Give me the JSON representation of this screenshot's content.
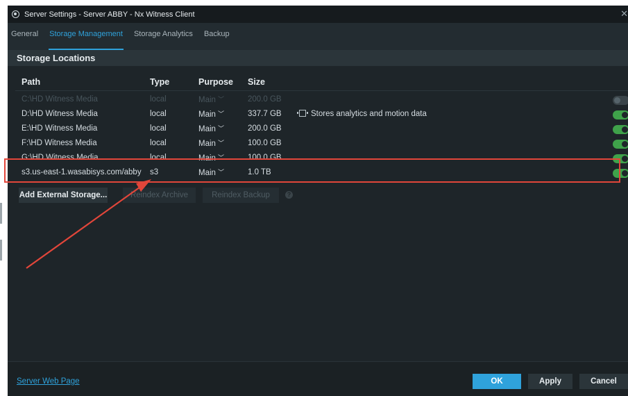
{
  "window": {
    "title": "Server Settings - Server ABBY - Nx Witness Client"
  },
  "tabs": [
    {
      "label": "General",
      "active": false
    },
    {
      "label": "Storage Management",
      "active": true
    },
    {
      "label": "Storage Analytics",
      "active": false
    },
    {
      "label": "Backup",
      "active": false
    }
  ],
  "storage": {
    "section_title": "Storage Locations",
    "columns": {
      "path": "Path",
      "type": "Type",
      "purpose": "Purpose",
      "size": "Size"
    },
    "rows": [
      {
        "path": "C:\\HD Witness Media",
        "type": "local",
        "purpose": "Main",
        "size": "200.0 GB",
        "note": "",
        "enabled": false
      },
      {
        "path": "D:\\HD Witness Media",
        "type": "local",
        "purpose": "Main",
        "size": "337.7 GB",
        "note": "Stores analytics and motion data",
        "enabled": true
      },
      {
        "path": "E:\\HD Witness Media",
        "type": "local",
        "purpose": "Main",
        "size": "200.0 GB",
        "note": "",
        "enabled": true
      },
      {
        "path": "F:\\HD Witness Media",
        "type": "local",
        "purpose": "Main",
        "size": "100.0 GB",
        "note": "",
        "enabled": true
      },
      {
        "path": "G:\\HD Witness Media",
        "type": "local",
        "purpose": "Main",
        "size": "100.0 GB",
        "note": "",
        "enabled": true
      },
      {
        "path": "s3.us-east-1.wasabisys.com/abby",
        "type": "s3",
        "purpose": "Main",
        "size": "1.0 TB",
        "note": "",
        "enabled": true
      }
    ]
  },
  "actions": {
    "add_external": "Add External Storage...",
    "reindex_archive": "Reindex Archive",
    "reindex_backup": "Reindex Backup",
    "help": "?"
  },
  "footer": {
    "web_page_link": "Server Web Page",
    "ok": "OK",
    "apply": "Apply",
    "cancel": "Cancel"
  },
  "colors": {
    "accent": "#2fa2db",
    "toggle_on": "#3fa24a",
    "annotation": "#e2463a"
  }
}
